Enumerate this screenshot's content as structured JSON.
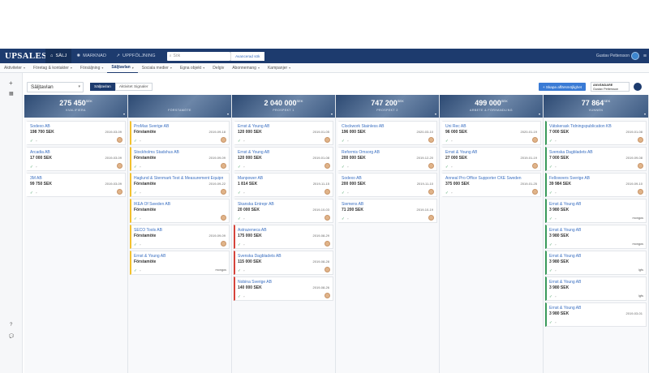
{
  "topbar": {
    "logo": "UPSALES",
    "nav": [
      {
        "icon": "home-icon",
        "glyph": "⌂",
        "label": "SÄLJ",
        "active": true
      },
      {
        "icon": "marketing-icon",
        "glyph": "✺",
        "label": "MARKNAD",
        "active": false
      },
      {
        "icon": "chart-icon",
        "glyph": "↗",
        "label": "UPPFÖLJNING",
        "active": false
      }
    ],
    "search_placeholder": "Sök",
    "search_scope": "Avancerad sök",
    "user_name": "Gustav Pettersson"
  },
  "subnav": {
    "items": [
      {
        "label": "Aktiviteter",
        "active": false,
        "dropdown": true
      },
      {
        "label": "Företag & kontakter",
        "active": false,
        "dropdown": true
      },
      {
        "label": "Försäljning",
        "active": false,
        "dropdown": true
      },
      {
        "label": "Säljtavlan",
        "active": true,
        "dropdown": true
      },
      {
        "label": "Sociala medier",
        "active": false,
        "dropdown": true
      },
      {
        "label": "Egna objekt",
        "active": false,
        "dropdown": true
      },
      {
        "label": "Delgiv",
        "active": false,
        "dropdown": false
      },
      {
        "label": "Abonnemang",
        "active": false,
        "dropdown": true
      },
      {
        "label": "Kampanjer",
        "active": false,
        "dropdown": true
      }
    ]
  },
  "toolbar": {
    "view_name": "Säljtavlan",
    "tabs": [
      {
        "label": "Säljtavlan",
        "active": true
      },
      {
        "label": "Aktivitet Signaler",
        "active": false
      }
    ],
    "add_button": "+ Skapa affärsmöjlighet",
    "owner_label": "ANVÄNDARE",
    "owner_value": "Gustav Pettersson"
  },
  "columns": [
    {
      "value": "275 450",
      "currency": "SEK",
      "stage": "KVALIFIERA",
      "cards": [
        {
          "name": "Sodexo AB",
          "amount": "198 700 SEK",
          "date": "2019-03-09",
          "color": "none",
          "who": "avatar"
        },
        {
          "name": "Arcadia AB",
          "amount": "17 000 SEK",
          "date": "2019-03-09",
          "color": "none",
          "who": "avatar"
        },
        {
          "name": "3M AB",
          "amount": "99 750 SEK",
          "date": "2019-03-09",
          "color": "none",
          "who": "avatar"
        }
      ]
    },
    {
      "value": "",
      "currency": "",
      "stage": "FÖRSTAMÖTE",
      "cards": [
        {
          "name": "ProMax Sverige AB",
          "amount": "Förstamöte",
          "date": "2019-09-18",
          "color": "yellow",
          "who": "avatar"
        },
        {
          "name": "Stockholms Stadshus AB",
          "amount": "Förstamöte",
          "date": "2019-09-09",
          "color": "yellow",
          "who": "avatar"
        },
        {
          "name": "Haglund & Stenmark Test & Measurement Equipm",
          "amount": "Förstamöte",
          "date": "2019-09-22",
          "color": "yellow",
          "who": "avatar"
        },
        {
          "name": "IKEA Of Sweden AB",
          "amount": "Förstamöte",
          "date": "",
          "color": "yellow",
          "who": "avatar"
        },
        {
          "name": "SECO Tools AB",
          "amount": "Förstamöte",
          "date": "2019-09-09",
          "color": "yellow",
          "who": "avatar"
        },
        {
          "name": "Ernst & Young AB",
          "amount": "Förstamöte",
          "date": "",
          "color": "yellow",
          "who": "mongos"
        }
      ]
    },
    {
      "value": "2 040 000",
      "currency": "SEK",
      "stage": "PROSPEKT 1",
      "cards": [
        {
          "name": "Ernst & Young AB",
          "amount": "120 000 SEK",
          "date": "2019-01-05",
          "color": "none",
          "who": "avatar"
        },
        {
          "name": "Ernst & Young AB",
          "amount": "120 000 SEK",
          "date": "2019-01-08",
          "color": "none",
          "who": "avatar"
        },
        {
          "name": "Manpower AB",
          "amount": "1 814 SEK",
          "date": "2019-11-15",
          "color": "none",
          "who": "avatar"
        },
        {
          "name": "Skanska Entrepr AB",
          "amount": "20 000 SEK",
          "date": "2019-10-03",
          "color": "none",
          "who": "avatar"
        },
        {
          "name": "Astrazeneca AB",
          "amount": "175 000 SEK",
          "date": "2019-08-29",
          "color": "red",
          "who": "avatar"
        },
        {
          "name": "Svenska Dagbladets AB",
          "amount": "115 000 SEK",
          "date": "2019-08-28",
          "color": "red",
          "who": "avatar"
        },
        {
          "name": "Nobina Sverige AB",
          "amount": "140 000 SEK",
          "date": "2019-08-26",
          "color": "red",
          "who": "avatar"
        }
      ]
    },
    {
      "value": "747 200",
      "currency": "SEK",
      "stage": "PROSPEKT 2",
      "cards": [
        {
          "name": "Clockwork Stainless AB",
          "amount": "196 000 SEK",
          "date": "2020-03-10",
          "color": "none",
          "who": "avatar"
        },
        {
          "name": "Reformis Omsorg AB",
          "amount": "200 000 SEK",
          "date": "2019-12-20",
          "color": "none",
          "who": "avatar"
        },
        {
          "name": "Sodexo AB",
          "amount": "200 000 SEK",
          "date": "2019-11-10",
          "color": "none",
          "who": "avatar"
        },
        {
          "name": "Siemens AB",
          "amount": "71 200 SEK",
          "date": "2019-10-19",
          "color": "none",
          "who": "avatar"
        }
      ]
    },
    {
      "value": "499 000",
      "currency": "SEK",
      "stage": "ARBETE & FÖRHANDLING",
      "cards": [
        {
          "name": "Uni Rec AB",
          "amount": "96 000 SEK",
          "date": "2020-01-19",
          "color": "none",
          "who": "avatar"
        },
        {
          "name": "Ernst & Young AB",
          "amount": "27 000 SEK",
          "date": "2019-01-19",
          "color": "none",
          "who": "avatar"
        },
        {
          "name": "Anneal Pro Office Supporter CKE Sweden",
          "amount": "375 000 SEK",
          "date": "2019-01-25",
          "color": "none",
          "who": "avatar"
        }
      ]
    },
    {
      "value": "77 864",
      "currency": "SEK",
      "stage": "VUNNEN",
      "cards": [
        {
          "name": "Vätskerask Tidningspublication KB",
          "amount": "7 000 SEK",
          "date": "2019-01-08",
          "color": "green",
          "who": "avatar"
        },
        {
          "name": "Svenska Dagbladets AB",
          "amount": "7 000 SEK",
          "date": "2019-09-08",
          "color": "green",
          "who": "avatar"
        },
        {
          "name": "Fellowvers Sverige AB",
          "amount": "39 984 SEK",
          "date": "2019-09-10",
          "color": "green",
          "who": "avatar"
        },
        {
          "name": "Ernst & Young AB",
          "amount": "3 980 SEK",
          "date": "",
          "color": "green",
          "who": "mongos"
        },
        {
          "name": "Ernst & Young AB",
          "amount": "3 980 SEK",
          "date": "",
          "color": "green",
          "who": "mongos"
        },
        {
          "name": "Ernst & Young AB",
          "amount": "3 980 SEK",
          "date": "",
          "color": "green",
          "who": "lgfs"
        },
        {
          "name": "Ernst & Young AB",
          "amount": "3 980 SEK",
          "date": "",
          "color": "green",
          "who": "lgfs"
        },
        {
          "name": "Ernst & Young AB",
          "amount": "3 980 SEK",
          "date": "2019-03-01",
          "color": "green",
          "who": "none"
        }
      ]
    }
  ],
  "leftrail": {
    "add": "+",
    "calendar": "▦",
    "help": "?",
    "chat": "💬"
  }
}
